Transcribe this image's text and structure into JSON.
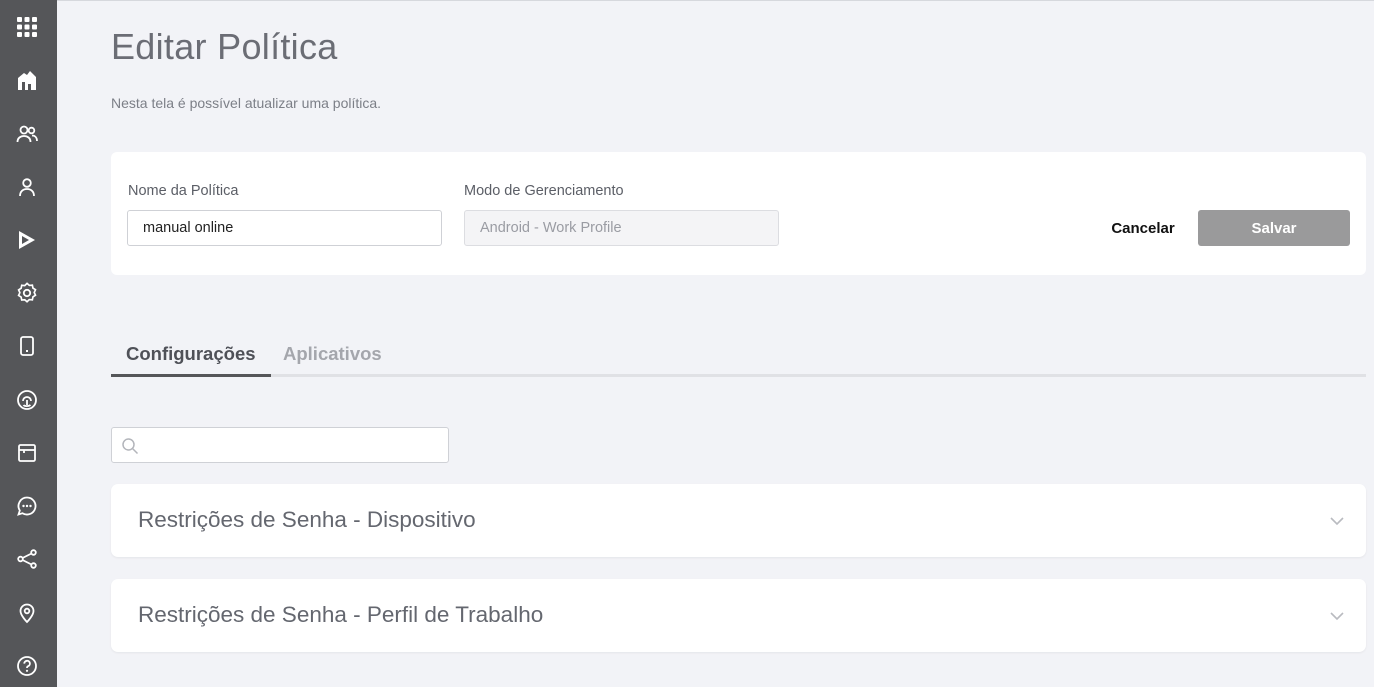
{
  "sidebar": {
    "icons": [
      {
        "name": "apps-grid-icon"
      },
      {
        "name": "dashboard-icon"
      },
      {
        "name": "users-group-icon"
      },
      {
        "name": "user-icon"
      },
      {
        "name": "play-store-icon"
      },
      {
        "name": "settings-icon"
      },
      {
        "name": "device-icon"
      },
      {
        "name": "fingerprint-icon"
      },
      {
        "name": "calendar-icon"
      },
      {
        "name": "chat-icon"
      },
      {
        "name": "share-icon"
      },
      {
        "name": "location-pin-icon"
      },
      {
        "name": "help-icon"
      }
    ]
  },
  "header": {
    "title": "Editar Política",
    "subtitle": "Nesta tela é possível atualizar uma política."
  },
  "form": {
    "policy_name_label": "Nome da Política",
    "policy_name_value": "manual online",
    "management_mode_label": "Modo de Gerenciamento",
    "management_mode_value": "Android - Work Profile",
    "cancel_label": "Cancelar",
    "save_label": "Salvar"
  },
  "tabs": [
    {
      "label": "Configurações",
      "active": true
    },
    {
      "label": "Aplicativos",
      "active": false
    }
  ],
  "search": {
    "placeholder": "",
    "value": ""
  },
  "sections": [
    {
      "title": "Restrições de Senha - Dispositivo"
    },
    {
      "title": "Restrições de Senha - Perfil de Trabalho"
    }
  ],
  "colors": {
    "sidebar_bg": "#555659",
    "page_bg": "#f2f3f7",
    "save_button_bg": "#9a9a9b"
  }
}
